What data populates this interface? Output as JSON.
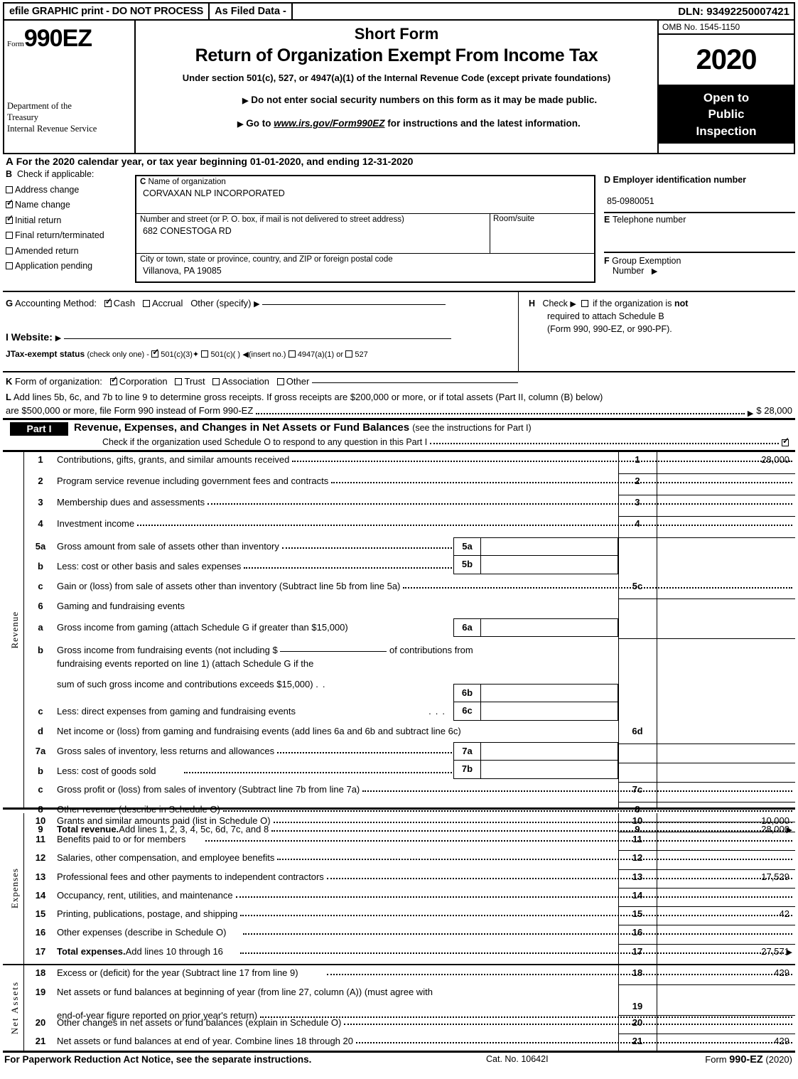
{
  "efile": {
    "graphic_print": "efile GRAPHIC print - DO NOT PROCESS",
    "as_filed": "As Filed Data -",
    "dln": "DLN: 93492250007421"
  },
  "masthead": {
    "form_label": "Form",
    "form_number": "990EZ",
    "department": "Department of the\nTreasury\nInternal Revenue Service",
    "dept_line1": "Department of the",
    "dept_line2": "Treasury",
    "dept_line3": "Internal Revenue Service",
    "short_form": "Short Form",
    "title": "Return of Organization Exempt From Income Tax",
    "subtitle": "Under section 501(c), 527, or 4947(a)(1) of the Internal Revenue Code (except private foundations)",
    "bullet1": "Do not enter social security numbers on this form as it may be made public.",
    "bullet2_pre": "Go to ",
    "bullet2_link": "www.irs.gov/Form990EZ",
    "bullet2_post": " for instructions and the latest information.",
    "omb": "OMB No. 1545-1150",
    "year": "2020",
    "open_to_public": "Open to\nPublic\nInspection",
    "open_line1": "Open to",
    "open_line2": "Public",
    "open_line3": "Inspection"
  },
  "line_a": {
    "letter": "A",
    "text_pre": "For the 2020 calendar year, or tax year beginning",
    "begin_date": "01-01-2020",
    "text_mid": ", and ending",
    "end_date": "12-31-2020"
  },
  "section_b": {
    "letter": "B",
    "header": "Check if applicable:",
    "options": [
      {
        "label": "Address change",
        "checked": false
      },
      {
        "label": "Name change",
        "checked": true
      },
      {
        "label": "Initial return",
        "checked": true
      },
      {
        "label": "Final return/terminated",
        "checked": false
      },
      {
        "label": "Amended return",
        "checked": false
      },
      {
        "label": "Application pending",
        "checked": false
      }
    ]
  },
  "section_c": {
    "letter": "C",
    "name_caption": "Name of organization",
    "name_value": "CORVAXAN NLP INCORPORATED",
    "street_caption": "Number and street (or P. O. box, if mail is not delivered to street address)",
    "street_value": "682 CONESTOGA RD",
    "room_caption": "Room/suite",
    "room_value": "",
    "city_caption": "City or town, state or province, country, and ZIP or foreign postal code",
    "city_value": "Villanova, PA  19085"
  },
  "section_d": {
    "letter": "D",
    "caption": "Employer identification number",
    "value": "85-0980051"
  },
  "section_e": {
    "letter": "E",
    "caption": "Telephone number",
    "value": ""
  },
  "section_f": {
    "letter": "F",
    "caption_line1": "Group Exemption",
    "caption_line2": "Number",
    "value": ""
  },
  "section_g": {
    "letter": "G",
    "label": "Accounting Method:",
    "cash_label": "Cash",
    "cash_checked": true,
    "accrual_label": "Accrual",
    "accrual_checked": false,
    "other_label": "Other (specify)",
    "other_value": ""
  },
  "section_h": {
    "letter": "H",
    "line1_pre": "Check",
    "line1_post_a": "if the organization is ",
    "line1_post_b": "not",
    "checked": false,
    "line2": "required to attach Schedule B",
    "line3": "(Form 990, 990-EZ, or 990-PF)."
  },
  "section_i": {
    "letter": "I",
    "label": "Website:",
    "value": ""
  },
  "section_j": {
    "letter": "J",
    "label": "Tax-exempt status",
    "note": "(check only one) -",
    "options": [
      {
        "label": "501(c)(3)",
        "checked": true
      },
      {
        "label": "501(c)(  )",
        "checked": false
      },
      {
        "label": "4947(a)(1) or",
        "checked": false
      },
      {
        "label": "527",
        "checked": false
      }
    ],
    "insert_no": "(insert no.)"
  },
  "section_k": {
    "letter": "K",
    "label": "Form of organization:",
    "options": [
      {
        "label": "Corporation",
        "checked": true
      },
      {
        "label": "Trust",
        "checked": false
      },
      {
        "label": "Association",
        "checked": false
      },
      {
        "label": "Other",
        "checked": false
      }
    ]
  },
  "section_l": {
    "letter": "L",
    "line1": "Add lines 5b, 6c, and 7b to line 9 to determine gross receipts. If gross receipts are $200,000 or more, or if total assets (Part II, column (B) below)",
    "line2": "are $500,000 or more, file Form 990 instead of Form 990-EZ",
    "amount_prefix": "$",
    "amount": "28,000"
  },
  "part1": {
    "badge": "Part I",
    "title": "Revenue, Expenses, and Changes in Net Assets or Fund Balances",
    "title_note": "(see the instructions for Part I)",
    "schedule_o_text": "Check if the organization used Schedule O to respond to any question in this Part I",
    "schedule_o_checked": true,
    "side_labels": {
      "revenue": "Revenue",
      "expenses": "Expenses",
      "net_assets": "Net Assets"
    }
  },
  "revenue_lines": [
    {
      "no": "1",
      "cell": "1",
      "text": "Contributions, gifts, grants, and similar amounts received",
      "dots": true,
      "amount": "28,000"
    },
    {
      "no": "2",
      "cell": "2",
      "text": "Program service revenue including government fees and contracts",
      "dots": true,
      "amount": ""
    },
    {
      "no": "3",
      "cell": "3",
      "text": "Membership dues and assessments",
      "dots": true,
      "amount": ""
    },
    {
      "no": "4",
      "cell": "4",
      "text": "Investment income",
      "dots": true,
      "amount": ""
    },
    {
      "no": "5a",
      "cell": "5a",
      "text": "Gross amount from sale of assets other than inventory",
      "dots": true,
      "amount": "",
      "inner": true
    },
    {
      "no": "b",
      "cell": "5b",
      "text": "Less: cost or other basis and sales expenses",
      "dots": true,
      "amount": "",
      "inner": true
    },
    {
      "no": "c",
      "cell": "5c",
      "text": "Gain or (loss) from sale of assets other than inventory (Subtract line 5b from line 5a)",
      "dots": true,
      "amount": ""
    },
    {
      "no": "6",
      "cell": "",
      "text": "Gaming and fundraising events",
      "dots": false,
      "amount": ""
    },
    {
      "no": "a",
      "cell": "6a",
      "text": "Gross income from gaming (attach Schedule G if greater than $15,000)",
      "dots": false,
      "amount": "",
      "inner": true
    },
    {
      "no": "b",
      "cell": "6b",
      "text": "Gross income from fundraising events (not including $",
      "text2": "of contributions from",
      "text3": "fundraising events reported on line 1) (attach Schedule G if the",
      "text4": "sum of such gross income and contributions exceeds $15,000)",
      "dots": false,
      "amount": "",
      "inner": true
    },
    {
      "no": "c",
      "cell": "6c",
      "text": "Less: direct expenses from gaming and fundraising events",
      "dots": true,
      "amount": "",
      "inner": true
    },
    {
      "no": "d",
      "cell": "6d",
      "text": "Net income or (loss) from gaming and fundraising events (add lines 6a and 6b and subtract line 6c)",
      "dots": false,
      "amount": ""
    },
    {
      "no": "7a",
      "cell": "7a",
      "text": "Gross sales of inventory, less returns and allowances",
      "dots": true,
      "amount": "",
      "inner": true
    },
    {
      "no": "b",
      "cell": "7b",
      "text": "Less: cost of goods sold",
      "dots": true,
      "amount": "",
      "inner": true
    },
    {
      "no": "c",
      "cell": "7c",
      "text": "Gross profit or (loss) from sales of inventory (Subtract line 7b from line 7a)",
      "dots": true,
      "amount": ""
    },
    {
      "no": "8",
      "cell": "8",
      "text": "Other revenue (describe in Schedule O)",
      "dots": true,
      "amount": ""
    },
    {
      "no": "9",
      "cell": "9",
      "text_bold": "Total revenue.",
      "text": " Add lines 1, 2, 3, 4, 5c, 6d, 7c, and 8",
      "dots": true,
      "amount": "28,000",
      "arrow": true
    }
  ],
  "expense_lines": [
    {
      "no": "10",
      "cell": "10",
      "text": "Grants and similar amounts paid (list in Schedule O)",
      "amount": "10,000"
    },
    {
      "no": "11",
      "cell": "11",
      "text": "Benefits paid to or for members",
      "amount": ""
    },
    {
      "no": "12",
      "cell": "12",
      "text": "Salaries, other compensation, and employee benefits",
      "amount": ""
    },
    {
      "no": "13",
      "cell": "13",
      "text": "Professional fees and other payments to independent contractors",
      "amount": "17,529"
    },
    {
      "no": "14",
      "cell": "14",
      "text": "Occupancy, rent, utilities, and maintenance",
      "amount": ""
    },
    {
      "no": "15",
      "cell": "15",
      "text": "Printing, publications, postage, and shipping",
      "amount": "42"
    },
    {
      "no": "16",
      "cell": "16",
      "text": "Other expenses (describe in Schedule O)",
      "amount": ""
    },
    {
      "no": "17",
      "cell": "17",
      "text_bold": "Total expenses.",
      "text": " Add lines 10 through 16",
      "amount": "27,571",
      "arrow": true
    }
  ],
  "netasset_lines": [
    {
      "no": "18",
      "cell": "18",
      "text": "Excess or (deficit) for the year (Subtract line 17 from line 9)",
      "amount": "429"
    },
    {
      "no": "19",
      "cell": "19",
      "text": "Net assets or fund balances at beginning of year (from line 27, column (A)) (must agree with",
      "text2": "end-of-year figure reported on prior year's return)",
      "amount": ""
    },
    {
      "no": "20",
      "cell": "20",
      "text": "Other changes in net assets or fund balances (explain in Schedule O)",
      "amount": ""
    },
    {
      "no": "21",
      "cell": "21",
      "text": "Net assets or fund balances at end of year. Combine lines 18 through 20",
      "amount": "429"
    }
  ],
  "footer": {
    "notice": "For Paperwork Reduction Act Notice, see the separate instructions.",
    "cat_no": "Cat. No. 10642I",
    "form_pre": "Form ",
    "form_name": "990-EZ",
    "form_year": " (2020)"
  }
}
